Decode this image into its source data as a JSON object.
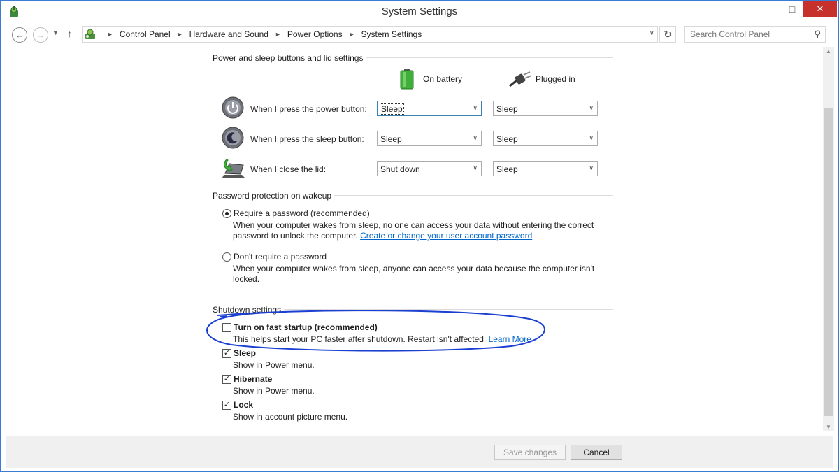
{
  "window": {
    "title": "System Settings"
  },
  "breadcrumb": [
    "Control Panel",
    "Hardware and Sound",
    "Power Options",
    "System Settings"
  ],
  "search": {
    "placeholder": "Search Control Panel"
  },
  "buttons_section": {
    "title": "Power and sleep buttons and lid settings",
    "col_battery": "On battery",
    "col_plugged": "Plugged in",
    "rows": [
      {
        "label": "When I press the power button:",
        "battery": "Sleep",
        "plugged": "Sleep",
        "icon": "power-button-icon"
      },
      {
        "label": "When I press the sleep button:",
        "battery": "Sleep",
        "plugged": "Sleep",
        "icon": "sleep-button-icon"
      },
      {
        "label": "When I close the lid:",
        "battery": "Shut down",
        "plugged": "Sleep",
        "icon": "laptop-lid-icon"
      }
    ]
  },
  "password_section": {
    "title": "Password protection on wakeup",
    "opt1_title": "Require a password (recommended)",
    "opt1_desc1": "When your computer wakes from sleep, no one can access your data without entering the correct",
    "opt1_desc2": "password to unlock the computer.",
    "opt1_link": "Create or change your user account password",
    "opt2_title": "Don't require a password",
    "opt2_desc1": "When your computer wakes from sleep, anyone can access your data because the computer isn't",
    "opt2_desc2": "locked.",
    "selected": "require"
  },
  "shutdown_section": {
    "title": "Shutdown settings",
    "fast_title": "Turn on fast startup (recommended)",
    "fast_desc": "This helps start your PC faster after shutdown. Restart isn't affected.",
    "fast_link": "Learn More",
    "fast_checked": false,
    "sleep_title": "Sleep",
    "sleep_desc": "Show in Power menu.",
    "hibernate_title": "Hibernate",
    "hibernate_desc": "Show in Power menu.",
    "lock_title": "Lock",
    "lock_desc": "Show in account picture menu."
  },
  "footer": {
    "save": "Save changes",
    "cancel": "Cancel"
  },
  "colors": {
    "accent": "#3a7bd5",
    "close": "#c7312b",
    "link": "#0066cc",
    "annotation": "#1a3fd1"
  }
}
